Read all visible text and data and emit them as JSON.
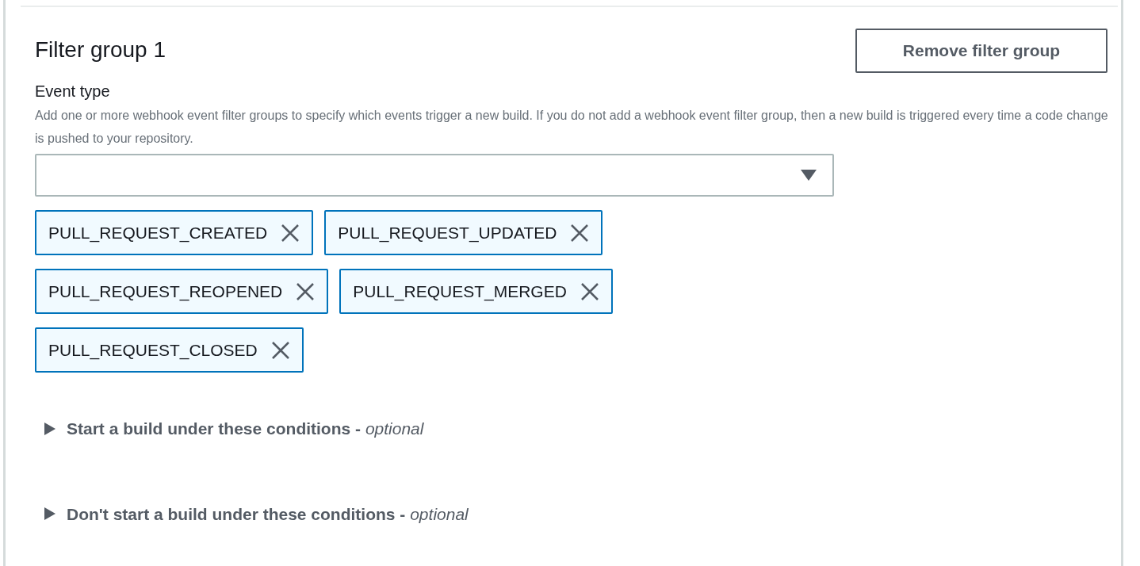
{
  "filter_group": {
    "title": "Filter group 1",
    "remove_button": "Remove filter group",
    "event_type": {
      "label": "Event type",
      "description": "Add one or more webhook event filter groups to specify which events trigger a new build. If you do not add a webhook event filter group, then a new build is triggered every time a code change is pushed to your repository.",
      "tokens": [
        {
          "label": "PULL_REQUEST_CREATED"
        },
        {
          "label": "PULL_REQUEST_UPDATED"
        },
        {
          "label": "PULL_REQUEST_REOPENED"
        },
        {
          "label": "PULL_REQUEST_MERGED"
        },
        {
          "label": "PULL_REQUEST_CLOSED"
        }
      ]
    },
    "sections": [
      {
        "label": "Start a build under these conditions - *optional*",
        "expanded": false
      },
      {
        "label": "Don't start a build under these conditions - *optional*",
        "expanded": false
      }
    ]
  }
}
